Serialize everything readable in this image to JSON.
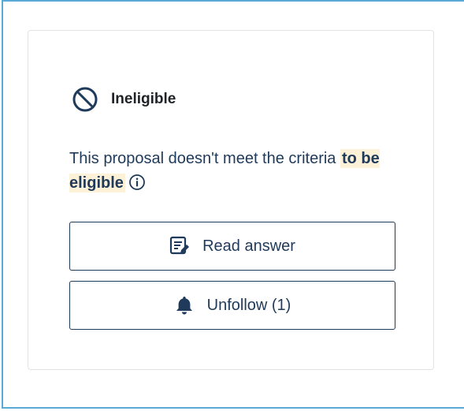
{
  "status": {
    "label": "Ineligible",
    "icon": "ban-icon"
  },
  "description": {
    "text": "This proposal doesn't meet the criteria ",
    "highlight": "to be eligible",
    "info_icon": "info-icon"
  },
  "actions": {
    "read_answer_label": "Read answer",
    "read_answer_icon": "edit-document-icon",
    "unfollow_label": "Unfollow (1)",
    "unfollow_icon": "bell-icon"
  },
  "colors": {
    "primary": "#1f3a5a",
    "highlight_bg": "#fdf1d7",
    "frame_border": "#5aa9d6"
  }
}
